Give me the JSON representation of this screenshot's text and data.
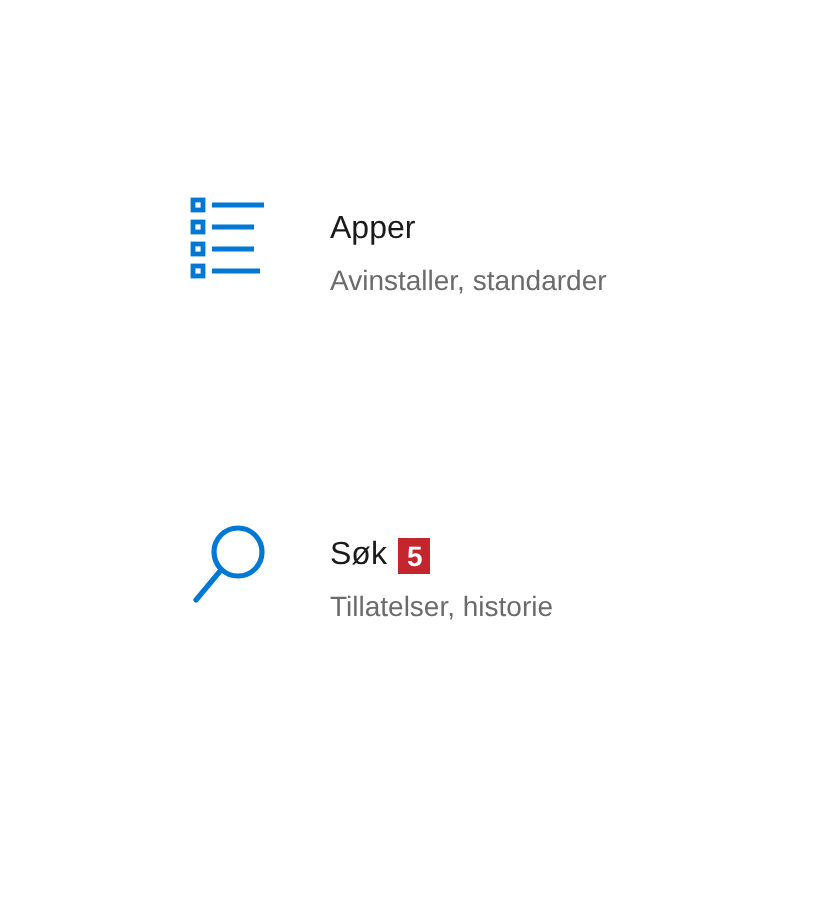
{
  "items": [
    {
      "kind": "apps",
      "title": "Apper",
      "subtitle": "Avinstaller, standarder"
    },
    {
      "kind": "search",
      "title": "Søk",
      "badge": "5",
      "subtitle": "Tillatelser, historie"
    }
  ]
}
